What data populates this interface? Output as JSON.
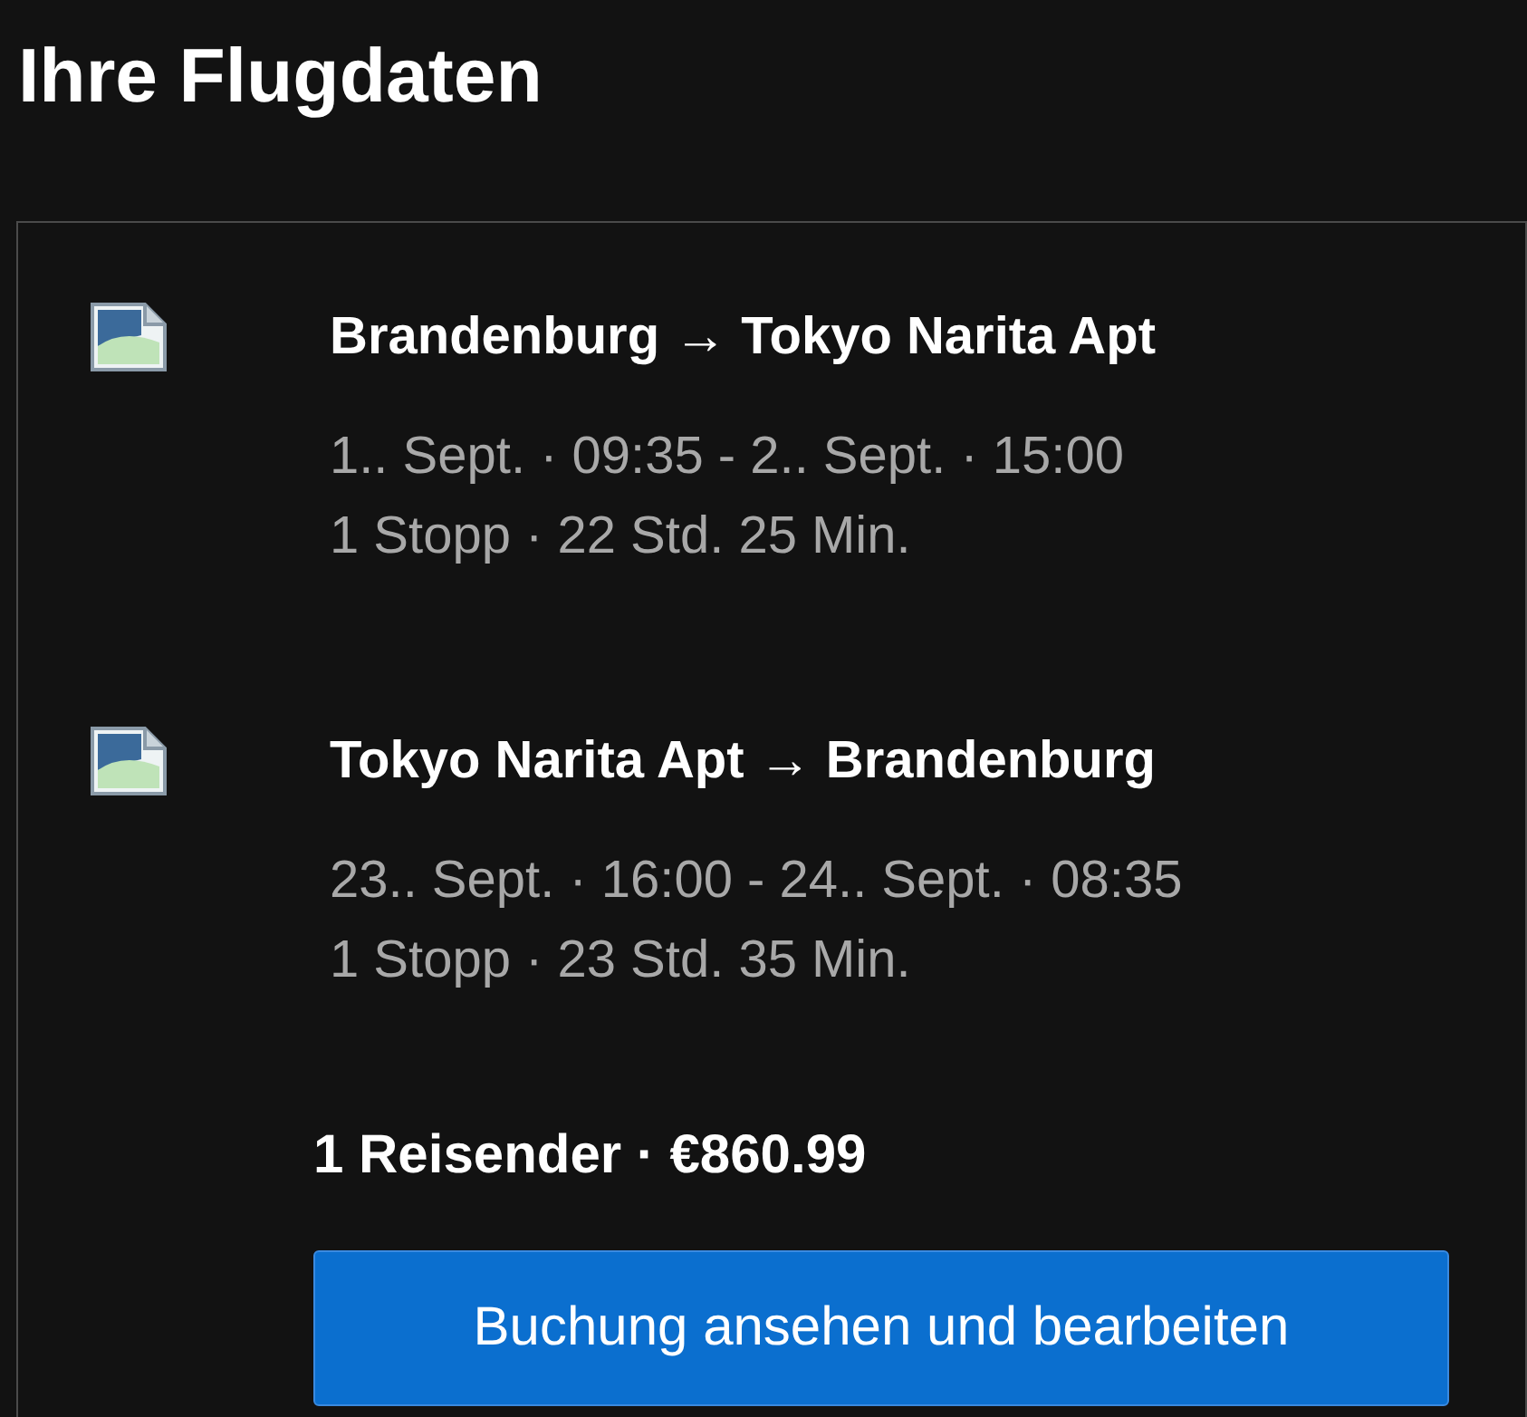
{
  "title": "Ihre Flugdaten",
  "flights": [
    {
      "route": "Brandenburg → Tokyo Narita Apt",
      "times": "1.. Sept. · 09:35 - 2.. Sept. · 15:00",
      "stops": "1 Stopp · 22 Std. 25 Min."
    },
    {
      "route": "Tokyo Narita Apt → Brandenburg",
      "times": "23.. Sept. · 16:00 - 24.. Sept. · 08:35",
      "stops": "1 Stopp · 23 Std. 35 Min."
    }
  ],
  "summary": "1 Reisender · €860.99",
  "button": "Buchung ansehen und bearbeiten"
}
